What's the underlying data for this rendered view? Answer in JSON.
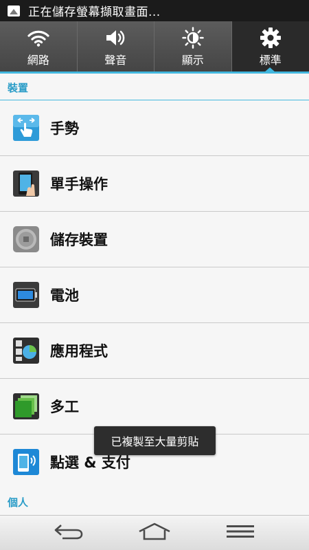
{
  "status_bar": {
    "notification_text": "正在儲存螢幕擷取畫面..."
  },
  "tabs": [
    {
      "label": "網路",
      "icon": "wifi-icon"
    },
    {
      "label": "聲音",
      "icon": "volume-icon"
    },
    {
      "label": "顯示",
      "icon": "brightness-icon"
    },
    {
      "label": "標準",
      "icon": "gear-icon",
      "active": true
    }
  ],
  "sections": {
    "device": "裝置",
    "personal": "個人"
  },
  "items": [
    {
      "label": "手勢",
      "icon": "gesture-icon"
    },
    {
      "label": "單手操作",
      "icon": "one-hand-icon"
    },
    {
      "label": "儲存裝置",
      "icon": "storage-icon"
    },
    {
      "label": "電池",
      "icon": "battery-icon"
    },
    {
      "label": "應用程式",
      "icon": "apps-icon"
    },
    {
      "label": "多工",
      "icon": "multitask-icon"
    },
    {
      "label": "點選 & 支付",
      "icon": "tap-pay-icon"
    }
  ],
  "toast": "已複製至大量剪貼",
  "navigation": [
    "back-icon",
    "home-icon",
    "menu-icon"
  ],
  "colors": {
    "accent": "#42b7de",
    "section_text": "#2a9cc7",
    "tab_bg": "#505050",
    "active_tab_bg": "#2a2a2a"
  }
}
